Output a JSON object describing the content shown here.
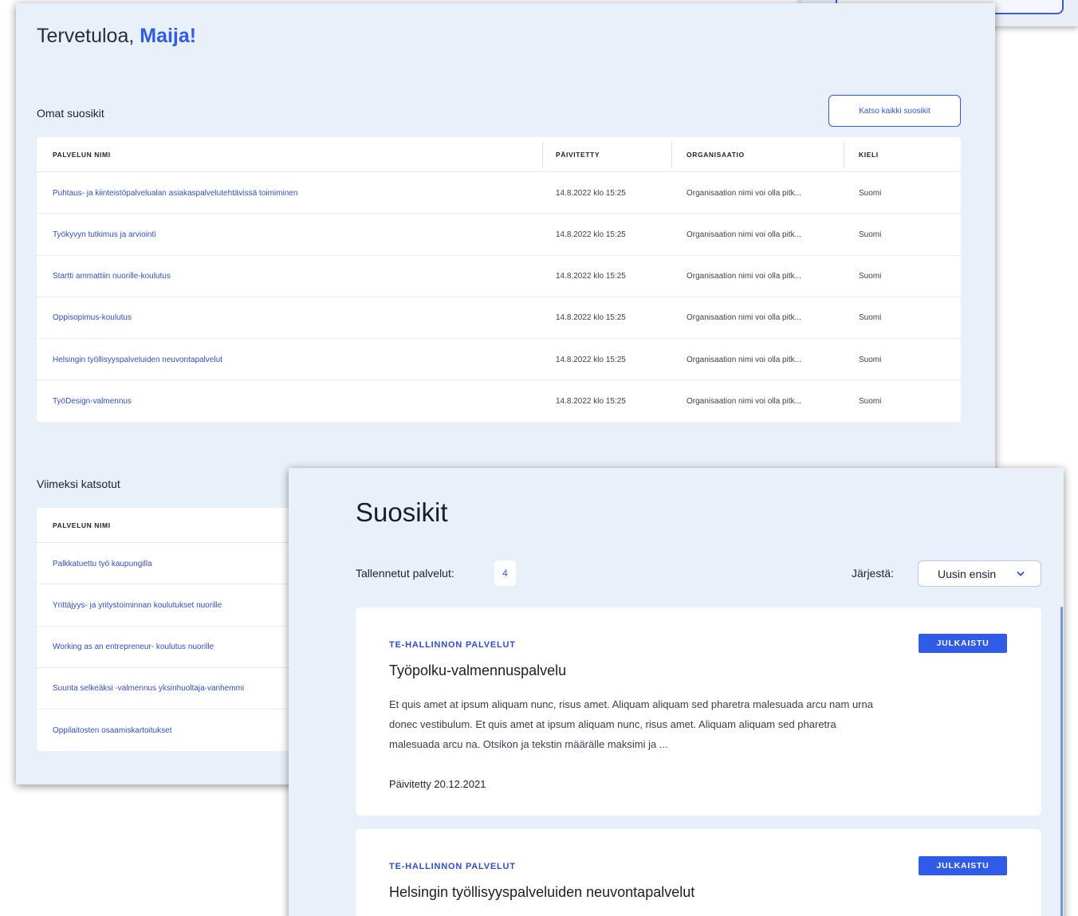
{
  "welcome": {
    "greeting": "Tervetuloa,",
    "name": "Maija!"
  },
  "favorites": {
    "title": "Omat suosikit",
    "view_all_button": "Katso kaikki suosikit",
    "columns": [
      "PALVELUN NIMI",
      "PÄIVITETTY",
      "ORGANISAATIO",
      "KIELI"
    ],
    "rows": [
      [
        "Puhtaus- ja kiinteistöpalvelualan asiakaspalvelutehtävissä toimiminen",
        "14.8.2022 klo 15:25",
        "Organisaation nimi voi olla pitk...",
        "Suomi"
      ],
      [
        "Työkyvyn tutkimus ja arviointi",
        "14.8.2022 klo 15:25",
        "Organisaation nimi voi olla pitk...",
        "Suomi"
      ],
      [
        "Startti ammattiin nuorille-koulutus",
        "14.8.2022 klo 15:25",
        "Organisaation nimi voi olla pitk...",
        "Suomi"
      ],
      [
        "Oppisopimus-koulutus",
        "14.8.2022 klo 15:25",
        "Organisaation nimi voi olla pitk...",
        "Suomi"
      ],
      [
        "Helsingin työllisyyspalveluiden neuvontapalvelut",
        "14.8.2022 klo 15:25",
        "Organisaation nimi voi olla pitk...",
        "Suomi"
      ],
      [
        "TyöDesign-valmennus",
        "14.8.2022 klo 15:25",
        "Organisaation nimi voi olla pitk...",
        "Suomi"
      ]
    ]
  },
  "recent": {
    "title": "Viimeksi katsotut",
    "columns": [
      "PALVELUN NIMI"
    ],
    "rows": [
      "Palkkatuettu työ kaupungilla",
      "Yrittäjyys- ja yritystoiminnan koulutukset nuorille",
      "Working as an entrepreneur- koulutus nuorille",
      "Suunta selkeäksi -valmennus yksinhuoltaja-vanhemmi",
      "Oppilaitosten osaamiskartoitukset"
    ]
  },
  "suosikit": {
    "title": "Suosikit",
    "saved_label": "Tallennetut palvelut:",
    "saved_count": "4",
    "sort_label": "Järjestä:",
    "sort_value": "Uusin ensin",
    "cards": [
      {
        "org": "TE-HALLINNON PALVELUT",
        "badge": "JULKAISTU",
        "title": "Työpolku-valmennuspalvelu",
        "description": "Et quis amet at ipsum aliquam nunc, risus amet. Aliquam aliquam sed pharetra malesuada arcu nam urna donec vestibulum. Et quis amet at ipsum aliquam nunc, risus amet. Aliquam aliquam sed pharetra malesuada arcu na. Otsikon ja tekstin määrälle maksimi ja ...",
        "updated": "Päivitetty 20.12.2021"
      },
      {
        "org": "TE-HALLINNON PALVELUT",
        "badge": "JULKAISTU",
        "title": "Helsingin työllisyyspalveluiden neuvontapalvelut"
      }
    ]
  },
  "colors": {
    "accent": "#2f5be8",
    "panel_bg": "#eaf0fa",
    "card_bg": "#ffffff"
  },
  "icons": {
    "sort_dropdown": "chevron-down-icon"
  }
}
